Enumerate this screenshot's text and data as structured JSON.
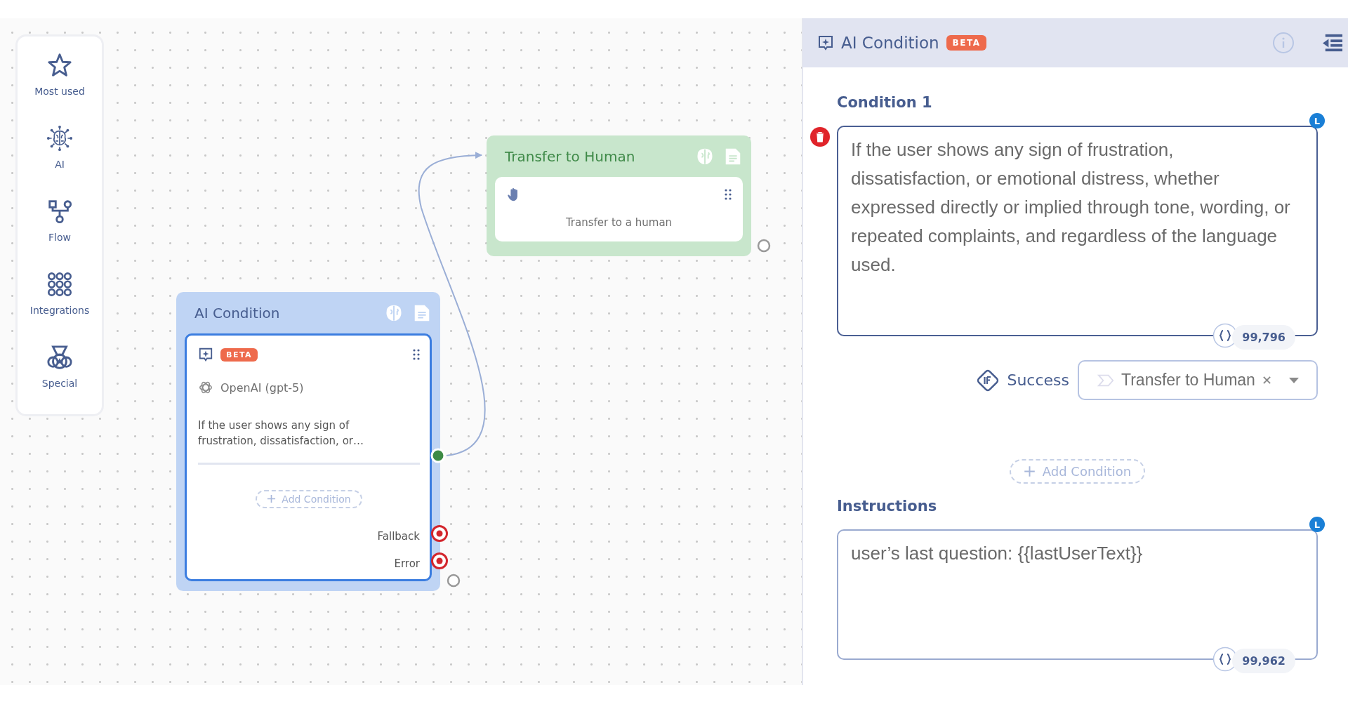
{
  "sidebar": {
    "items": [
      {
        "label": "Most used",
        "kind": "star"
      },
      {
        "label": "AI",
        "kind": "brain"
      },
      {
        "label": "Flow",
        "kind": "flow"
      },
      {
        "label": "Integrations",
        "kind": "grid"
      },
      {
        "label": "Special",
        "kind": "medal"
      }
    ]
  },
  "transfer_node": {
    "title": "Transfer to Human",
    "step_label": "Transfer to a human"
  },
  "condition_node": {
    "title": "AI Condition",
    "badge": "BETA",
    "model": "OpenAI (gpt-5)",
    "condition_preview": "If the user shows any sign of frustration, dissatisfaction, or…",
    "add_button": "Add Condition",
    "outputs": [
      {
        "label": "Fallback"
      },
      {
        "label": "Error"
      }
    ]
  },
  "panel": {
    "title": "AI Condition",
    "badge": "BETA",
    "conditions": [
      {
        "heading": "Condition 1",
        "text": "If the user shows any sign of frustration, dissatisfaction, or emotional distress, whether expressed directly or implied through tone, wording, or repeated complaints, and regardless of the language used.",
        "count": "99,796",
        "language_badge": "L",
        "branch_label": "Success",
        "target": "Transfer to Human"
      }
    ],
    "add_button": "Add Condition",
    "instructions": {
      "heading": "Instructions",
      "text": "user’s last question: {{lastUserText}}",
      "count": "99,962",
      "language_badge": "L"
    }
  }
}
